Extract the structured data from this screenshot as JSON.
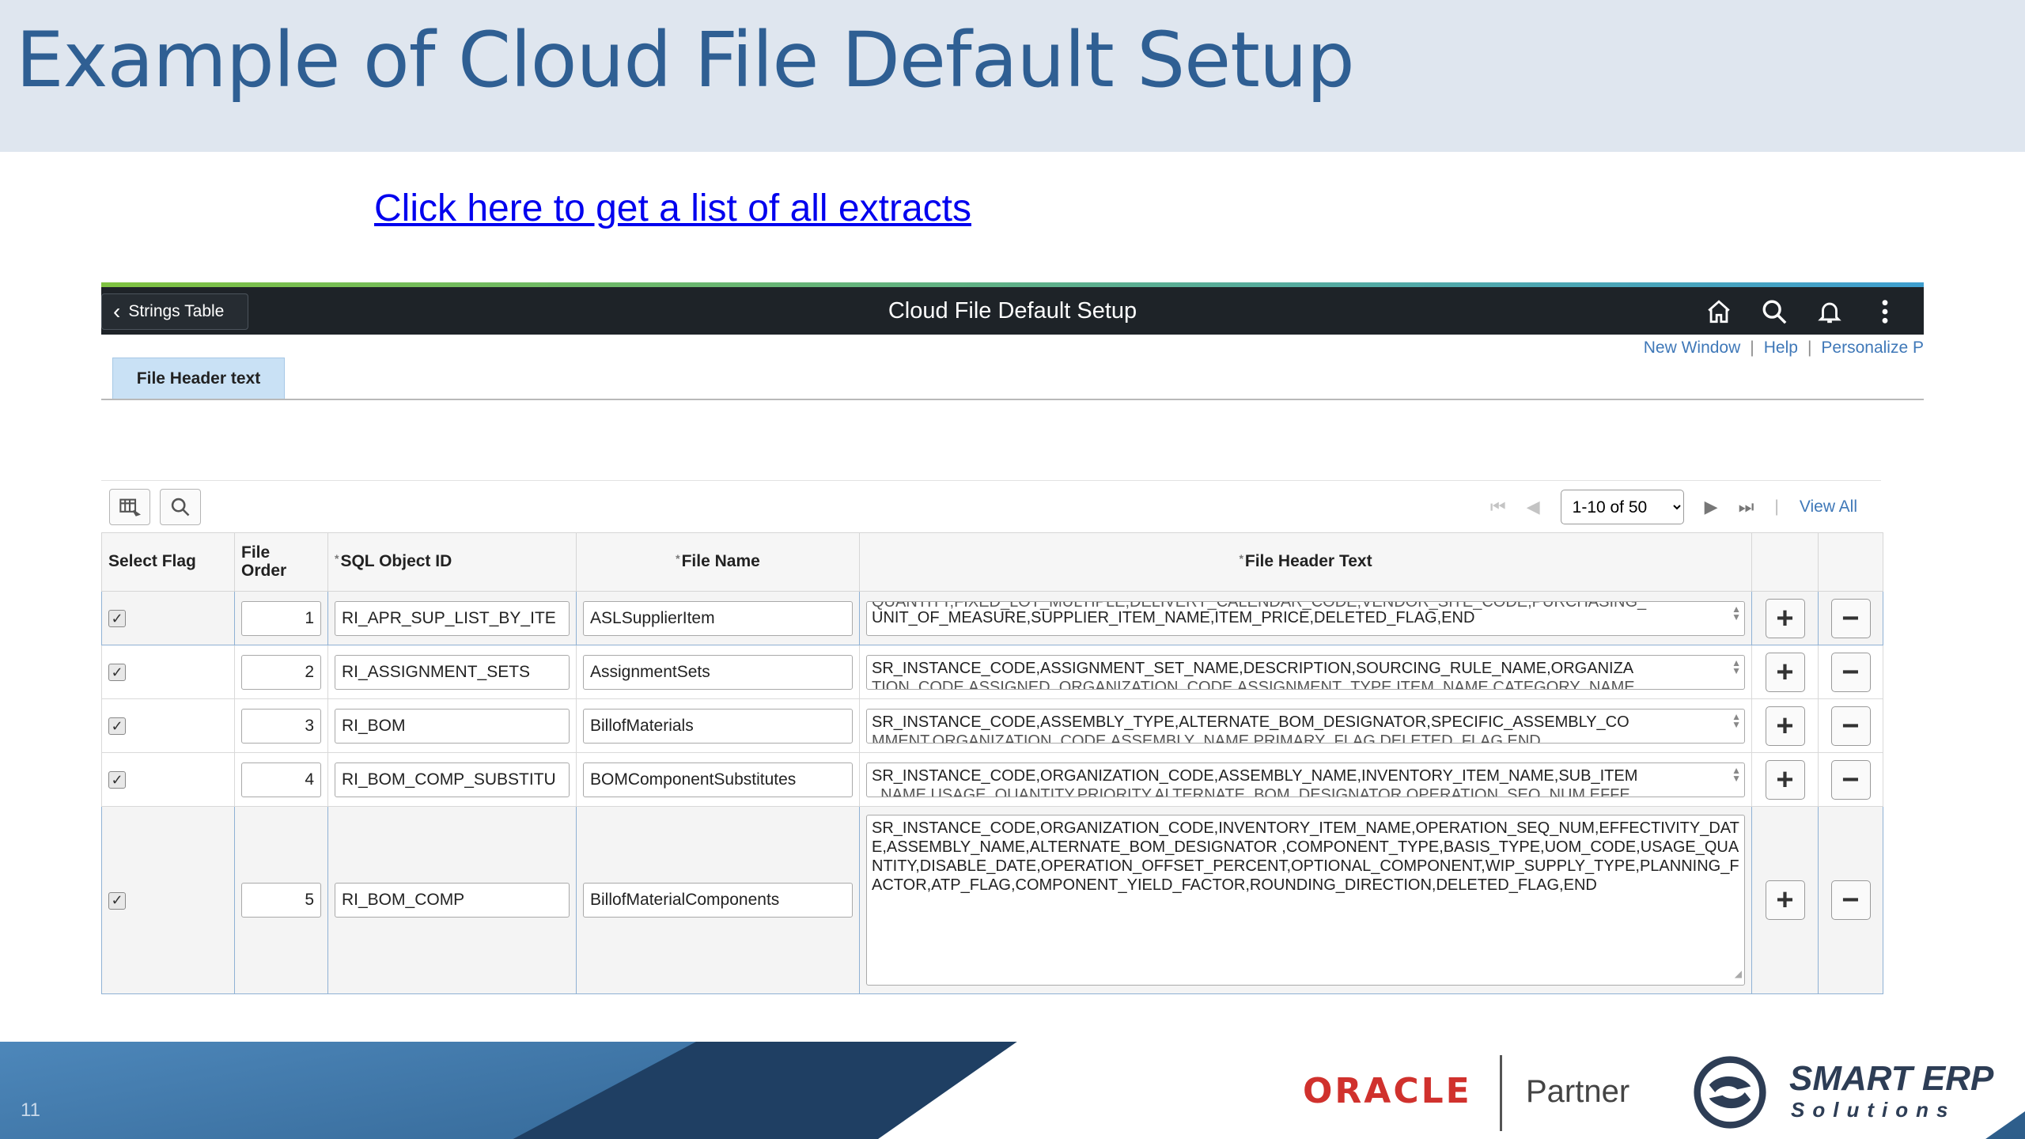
{
  "slide": {
    "title": "Example of Cloud File Default Setup",
    "link_text": "Click here to get a list of all extracts",
    "page_number": "11"
  },
  "app": {
    "back_label": "Strings Table",
    "title": "Cloud File Default Setup",
    "icons": [
      "home-icon",
      "search-icon",
      "bell-icon",
      "kebab-menu-icon"
    ],
    "links": {
      "new_window": "New Window",
      "help": "Help",
      "personalize": "Personalize P"
    },
    "tab_label": "File Header text"
  },
  "grid": {
    "pager_value": "1-10 of 50",
    "view_all": "View All",
    "columns": {
      "select_flag": "Select Flag",
      "file_order": "File Order",
      "sql_object_id": "SQL Object ID",
      "file_name": "File Name",
      "file_header_text": "File Header Text"
    },
    "rows": [
      {
        "order": "1",
        "sql_id": "RI_APR_SUP_LIST_BY_ITE",
        "file_name": "ASLSupplierItem",
        "header_text_top": "QUANTITY,FIXED_LOT_MULTIPLE,DELIVERY_CALENDAR_CODE,VENDOR_SITE_CODE,PURCHASING_",
        "header_text": "UNIT_OF_MEASURE,SUPPLIER_ITEM_NAME,ITEM_PRICE,DELETED_FLAG,END"
      },
      {
        "order": "2",
        "sql_id": "RI_ASSIGNMENT_SETS",
        "file_name": "AssignmentSets",
        "header_text": "SR_INSTANCE_CODE,ASSIGNMENT_SET_NAME,DESCRIPTION,SOURCING_RULE_NAME,ORGANIZA",
        "header_text_next": "TION_CODE,ASSIGNED_ORGANIZATION_CODE,ASSIGNMENT_TYPE,ITEM_NAME,CATEGORY_NAME"
      },
      {
        "order": "3",
        "sql_id": "RI_BOM",
        "file_name": "BillofMaterials",
        "header_text": "SR_INSTANCE_CODE,ASSEMBLY_TYPE,ALTERNATE_BOM_DESIGNATOR,SPECIFIC_ASSEMBLY_CO",
        "header_text_next": "MMENT,ORGANIZATION_CODE,ASSEMBLY_NAME,PRIMARY_FLAG,DELETED_FLAG,END"
      },
      {
        "order": "4",
        "sql_id": "RI_BOM_COMP_SUBSTITU",
        "file_name": "BOMComponentSubstitutes",
        "header_text": "SR_INSTANCE_CODE,ORGANIZATION_CODE,ASSEMBLY_NAME,INVENTORY_ITEM_NAME,SUB_ITEM",
        "header_text_next": "_NAME,USAGE_QUANTITY,PRIORITY,ALTERNATE_BOM_DESIGNATOR,OPERATION_SEQ_NUM,EFFE"
      },
      {
        "order": "5",
        "sql_id": "RI_BOM_COMP",
        "file_name": "BillofMaterialComponents",
        "header_text": "SR_INSTANCE_CODE,ORGANIZATION_CODE,INVENTORY_ITEM_NAME,OPERATION_SEQ_NUM,EFFECTIVITY_DATE,ASSEMBLY_NAME,ALTERNATE_BOM_DESIGNATOR ,COMPONENT_TYPE,BASIS_TYPE,UOM_CODE,USAGE_QUANTITY,DISABLE_DATE,OPERATION_OFFSET_PERCENT,OPTIONAL_COMPONENT,WIP_SUPPLY_TYPE,PLANNING_FACTOR,ATP_FLAG,COMPONENT_YIELD_FACTOR,ROUNDING_DIRECTION,DELETED_FLAG,END"
      }
    ]
  },
  "footer": {
    "oracle": "ORACLE",
    "partner": "Partner",
    "brand": "SMART ERP",
    "brand_sub": "Solutions"
  },
  "colors": {
    "title_band": "#dfe6ef",
    "title_text": "#2f5f93",
    "app_header": "#1e2328",
    "tab": "#c9e1f5",
    "link": "#3f78b8",
    "footer": "#3a6f9f",
    "oracle_red": "#d0312d"
  }
}
